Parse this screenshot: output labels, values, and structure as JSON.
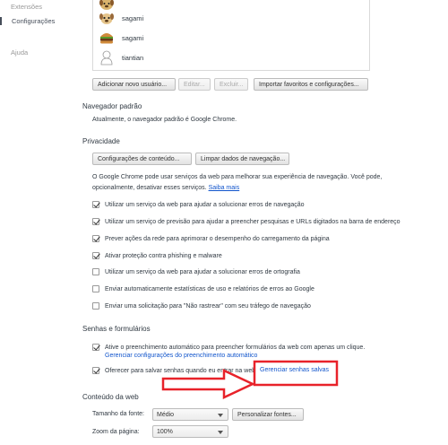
{
  "sidebar": {
    "items": [
      {
        "label": "Extensões"
      },
      {
        "label": "Configurações"
      },
      {
        "label": "Ajuda"
      }
    ]
  },
  "users": [
    {
      "name": "sagami",
      "avatar": "dog-avatar-icon"
    },
    {
      "name": "sagami",
      "avatar": "burger-avatar-icon"
    },
    {
      "name": "tiantian",
      "avatar": "silhouette-avatar-icon"
    }
  ],
  "user_buttons": {
    "add": "Adicionar novo usuário...",
    "edit": "Editar...",
    "delete": "Excluir...",
    "import": "Importar favoritos e configurações..."
  },
  "default_browser": {
    "title": "Navegador padrão",
    "text": "Atualmente, o navegador padrão é Google Chrome."
  },
  "privacy": {
    "title": "Privacidade",
    "content_settings_button": "Configurações de conteúdo...",
    "clear_data_button": "Limpar dados de navegação...",
    "description_line1": "O Google Chrome pode usar serviços da web para melhorar sua experiência de navegação. Você pode,",
    "description_line2": "opcionalmente, desativar esses serviços.",
    "learn_more": "Saiba mais",
    "options": [
      {
        "label": "Utilizar um serviço da web para ajudar a solucionar erros de navegação",
        "checked": true
      },
      {
        "label": "Utilizar um serviço de previsão para ajudar a preencher pesquisas e URLs digitados na barra de endereço",
        "checked": true
      },
      {
        "label": "Prever ações da rede para aprimorar o desempenho do carregamento da página",
        "checked": true
      },
      {
        "label": "Ativar proteção contra phishing e malware",
        "checked": true
      },
      {
        "label": "Utilizar um serviço da web para ajudar a solucionar erros de ortografia",
        "checked": false
      },
      {
        "label": "Enviar automaticamente estatísticas de uso e relatórios de erros ao Google",
        "checked": false
      },
      {
        "label": "Enviar uma solicitação para \"Não rastrear\" com seu tráfego de navegação",
        "checked": false
      }
    ]
  },
  "passwords": {
    "title": "Senhas e formulários",
    "autofill_label": "Ative o preenchimento automático para preencher formulários da web com apenas um clique.",
    "autofill_checked": true,
    "autofill_link": "Gerenciar configurações do preenchimento automático",
    "save_label": "Oferecer para salvar senhas quando eu entrar na web",
    "save_checked": true,
    "manage_link": "Gerenciar senhas salvas"
  },
  "web_content": {
    "title": "Conteúdo da web",
    "font_size_label": "Tamanho da fonte:",
    "font_size_value": "Médio",
    "customize_fonts_button": "Personalizar fontes...",
    "zoom_label": "Zoom da página:",
    "zoom_value": "100%"
  },
  "annotation": {
    "color": "#e8222a"
  }
}
